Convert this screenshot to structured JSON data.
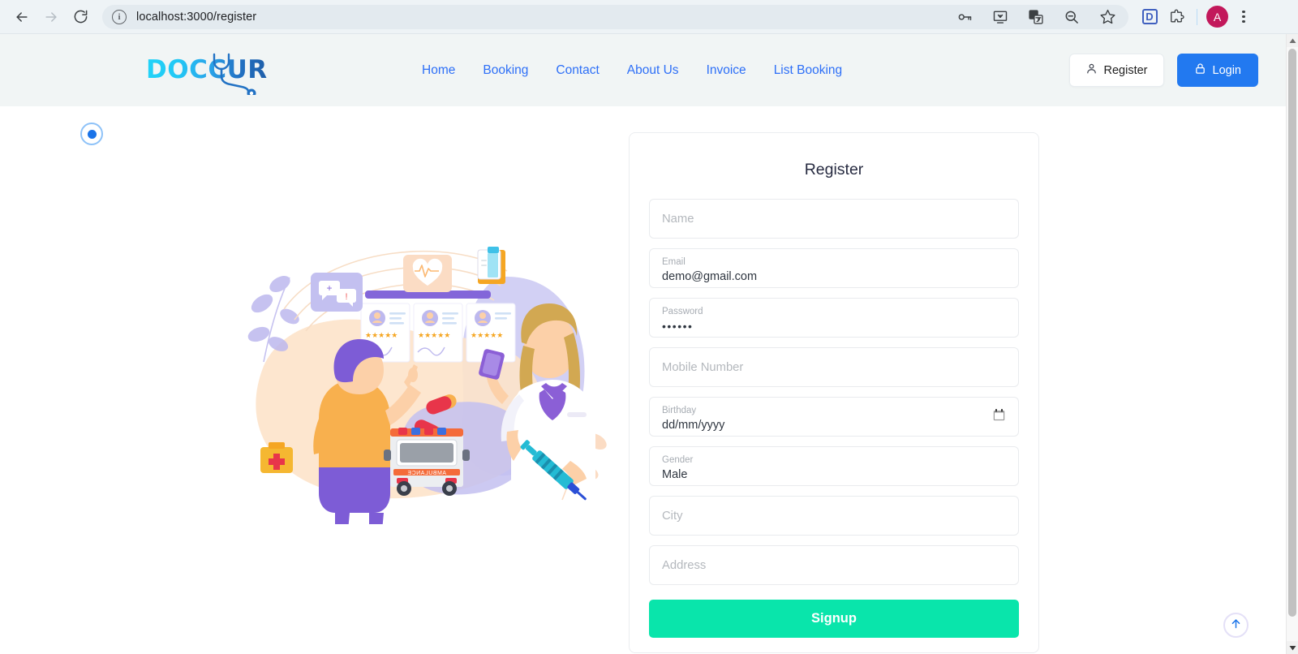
{
  "browser": {
    "back_icon": "arrow-left-icon",
    "forward_icon": "arrow-right-icon",
    "reload_icon": "reload-icon",
    "site_info_glyph": "i",
    "url": "localhost:3000/register",
    "toolbar_icons": [
      "password-key-icon",
      "install-app-icon",
      "translate-icon",
      "zoom-out-icon",
      "bookmark-star-icon"
    ],
    "extension_d_label": "D",
    "extensions_icon": "puzzle-piece-icon",
    "profile_initial": "A",
    "menu_icon": "kebab-menu-icon"
  },
  "header": {
    "logo_text": "DOCCURE",
    "nav": [
      {
        "label": "Home"
      },
      {
        "label": "Booking"
      },
      {
        "label": "Contact"
      },
      {
        "label": "About Us"
      },
      {
        "label": "Invoice"
      },
      {
        "label": "List Booking"
      }
    ],
    "register_button": "Register",
    "login_button": "Login",
    "background_color": "#f1f5f5",
    "nav_link_color": "#2d6ff7",
    "login_button_color": "#2279f0"
  },
  "form": {
    "title": "Register",
    "fields": [
      {
        "name": "name",
        "label": "",
        "placeholder": "Name",
        "value": ""
      },
      {
        "name": "email",
        "label": "Email",
        "placeholder": "Email",
        "value": "demo@gmail.com"
      },
      {
        "name": "password",
        "label": "Password",
        "placeholder": "Password",
        "value": "••••••"
      },
      {
        "name": "mobile",
        "label": "",
        "placeholder": "Mobile Number",
        "value": ""
      },
      {
        "name": "birthday",
        "label": "Birthday",
        "placeholder": "dd/mm/yyyy",
        "value": "dd/mm/yyyy"
      },
      {
        "name": "gender",
        "label": "Gender",
        "placeholder": "Gender",
        "value": "Male"
      },
      {
        "name": "city",
        "label": "",
        "placeholder": "City",
        "value": ""
      },
      {
        "name": "address",
        "label": "",
        "placeholder": "Address",
        "value": ""
      }
    ],
    "submit_label": "Signup",
    "submit_color": "#09e5ab"
  },
  "misc": {
    "status_dot_color": "#1a73e8",
    "scroll_top_icon": "arrow-up-icon",
    "illustration_alt": "medical-consultation-illustration"
  }
}
